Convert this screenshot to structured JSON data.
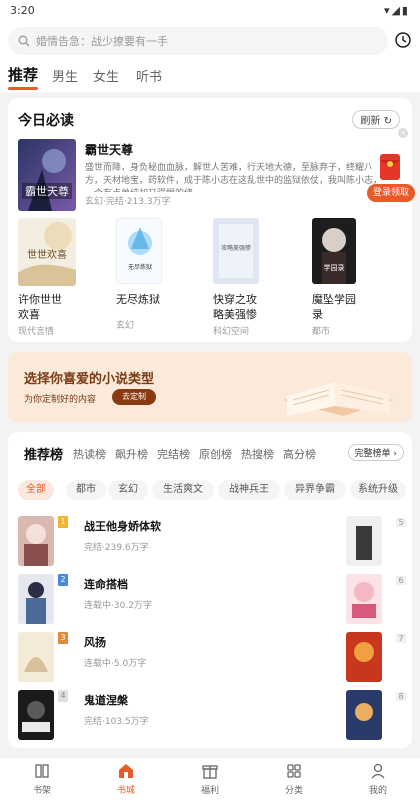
{
  "status": {
    "time": "3:20",
    "icons": "▾◢▮"
  },
  "search": {
    "placeholder": "婚情告急：战少撩要有一手"
  },
  "tabs": [
    {
      "label": "推荐",
      "active": true
    },
    {
      "label": "男生"
    },
    {
      "label": "女生"
    },
    {
      "label": "听书"
    }
  ],
  "daily": {
    "title": "今日必读",
    "refresh_label": "刷新",
    "featured": {
      "title": "霸世天尊",
      "desc": "盛世而降，身负秘血血脉，解世人苦难，行天地大德，至脉弃子，终耀八方，天材地宝，药软件，成于陈小志在这乱世中的监狱依仗，我叫陈小志，一个有点单纯却又强悍的修",
      "genre": "玄幻",
      "status": "完结",
      "words": "213.3万字",
      "cover_text": "霸世天尊"
    },
    "books": [
      {
        "title": "许你世世\n欢喜",
        "tag": "现代言情",
        "cover_text": "世世欢喜"
      },
      {
        "title": "无尽炼狱",
        "tag": "玄幻",
        "cover_text": "无尽炼狱"
      },
      {
        "title": "快穿之攻\n略美强惨",
        "tag": "科幻空间",
        "cover_text": "攻略美强惨"
      },
      {
        "title": "魔坠学园\n录",
        "tag": "都市",
        "cover_text": "学园录"
      }
    ],
    "login_label": "登录领取"
  },
  "banner": {
    "title": "选择你喜爱的小说类型",
    "subtitle": "为你定制好的内容",
    "button": "去定制"
  },
  "ranking": {
    "tabs": [
      "推荐榜",
      "热读榜",
      "飙升榜",
      "完结榜",
      "原创榜",
      "热搜榜",
      "高分榜"
    ],
    "all_label": "完整榜单",
    "chips": [
      "全部",
      "都市",
      "玄幻",
      "生活爽文",
      "战神兵王",
      "异界争霸",
      "系统升级"
    ],
    "items": [
      {
        "rank": "1",
        "title": "战王他身娇体软",
        "status": "完结",
        "words": "239.6万字",
        "side": "5"
      },
      {
        "rank": "2",
        "title": "连命搭档",
        "status": "连载中",
        "words": "30.2万字",
        "side": "6"
      },
      {
        "rank": "3",
        "title": "风扬",
        "status": "连载中",
        "words": "5.0万字",
        "side": "7"
      },
      {
        "rank": "4",
        "title": "鬼道涅槃",
        "status": "完结",
        "words": "103.5万字",
        "side": "8"
      }
    ],
    "sep": "·"
  },
  "nav": [
    {
      "label": "书架",
      "icon": "bookshelf-icon"
    },
    {
      "label": "书城",
      "icon": "bookstore-icon",
      "active": true
    },
    {
      "label": "福利",
      "icon": "gift-icon"
    },
    {
      "label": "分类",
      "icon": "grid-icon"
    },
    {
      "label": "我的",
      "icon": "person-icon"
    }
  ],
  "colors": {
    "accent": "#e85a2a",
    "banner_bg": "#fbe9d9"
  }
}
